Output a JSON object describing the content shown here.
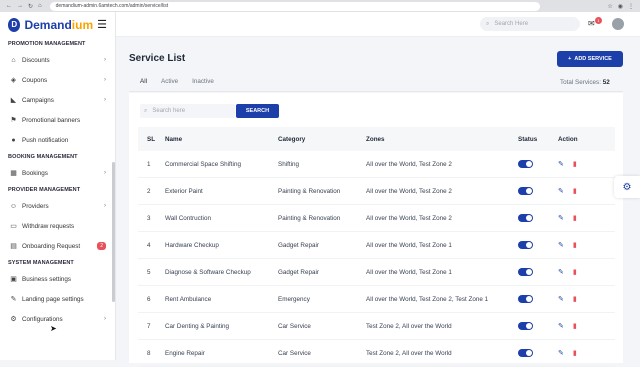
{
  "browser": {
    "url": "demandium-admin.6amtech.com/admin/service/list"
  },
  "brand": {
    "name_main": "Demand",
    "name_accent": "ium",
    "logo_letter": "D"
  },
  "sidebar": {
    "sections": [
      {
        "title": "PROMOTION MANAGEMENT",
        "items": [
          {
            "label": "Discounts",
            "icon": "tag-icon",
            "chevron": true
          },
          {
            "label": "Coupons",
            "icon": "ticket-icon",
            "chevron": true
          },
          {
            "label": "Campaigns",
            "icon": "megaphone-icon",
            "chevron": true
          },
          {
            "label": "Promotional banners",
            "icon": "flag-icon",
            "chevron": false
          },
          {
            "label": "Push notification",
            "icon": "bell-icon",
            "chevron": false
          }
        ]
      },
      {
        "title": "BOOKING MANAGEMENT",
        "items": [
          {
            "label": "Bookings",
            "icon": "calendar-icon",
            "chevron": true
          }
        ]
      },
      {
        "title": "PROVIDER MANAGEMENT",
        "items": [
          {
            "label": "Providers",
            "icon": "user-icon",
            "chevron": true
          },
          {
            "label": "Withdraw requests",
            "icon": "wallet-icon",
            "chevron": false
          },
          {
            "label": "Onboarding Request",
            "icon": "clipboard-icon",
            "badge": "2"
          }
        ]
      },
      {
        "title": "SYSTEM MANAGEMENT",
        "items": [
          {
            "label": "Business settings",
            "icon": "briefcase-icon",
            "chevron": false
          },
          {
            "label": "Landing page settings",
            "icon": "layout-icon",
            "chevron": false
          },
          {
            "label": "Configurations",
            "icon": "gear-icon",
            "chevron": true
          }
        ]
      }
    ]
  },
  "header": {
    "search_placeholder": "Search Here",
    "notification_count": "1"
  },
  "main": {
    "title": "Service List",
    "add_button": "ADD SERVICE",
    "tabs": [
      "All",
      "Active",
      "Inactive"
    ],
    "total_label": "Total Services:",
    "total_value": "52",
    "search_placeholder": "Search here",
    "search_button": "SEARCH",
    "columns": [
      "SL",
      "Name",
      "Category",
      "Zones",
      "Status",
      "Action"
    ],
    "rows": [
      {
        "sl": "1",
        "name": "Commercial Space Shifting",
        "category": "Shifting",
        "zones": "All over the World, Test Zone 2"
      },
      {
        "sl": "2",
        "name": "Exterior Paint",
        "category": "Painting & Renovation",
        "zones": "All over the World, Test Zone 2"
      },
      {
        "sl": "3",
        "name": "Wall Contruction",
        "category": "Painting & Renovation",
        "zones": "All over the World, Test Zone 2"
      },
      {
        "sl": "4",
        "name": "Hardware Checkup",
        "category": "Gadget Repair",
        "zones": "All over the World, Test Zone 1"
      },
      {
        "sl": "5",
        "name": "Diagnose & Software Checkup",
        "category": "Gadget Repair",
        "zones": "All over the World, Test Zone 1"
      },
      {
        "sl": "6",
        "name": "Rent Ambulance",
        "category": "Emergency",
        "zones": "All over the World, Test Zone 2, Test Zone 1"
      },
      {
        "sl": "7",
        "name": "Car Denting & Painting",
        "category": "Car Service",
        "zones": "Test Zone 2, All over the World"
      },
      {
        "sl": "8",
        "name": "Engine Repair",
        "category": "Car Service",
        "zones": "Test Zone 2, All over the World"
      }
    ]
  },
  "colors": {
    "primary": "#1c3faa",
    "accent": "#f7a500",
    "danger": "#e8505b"
  }
}
